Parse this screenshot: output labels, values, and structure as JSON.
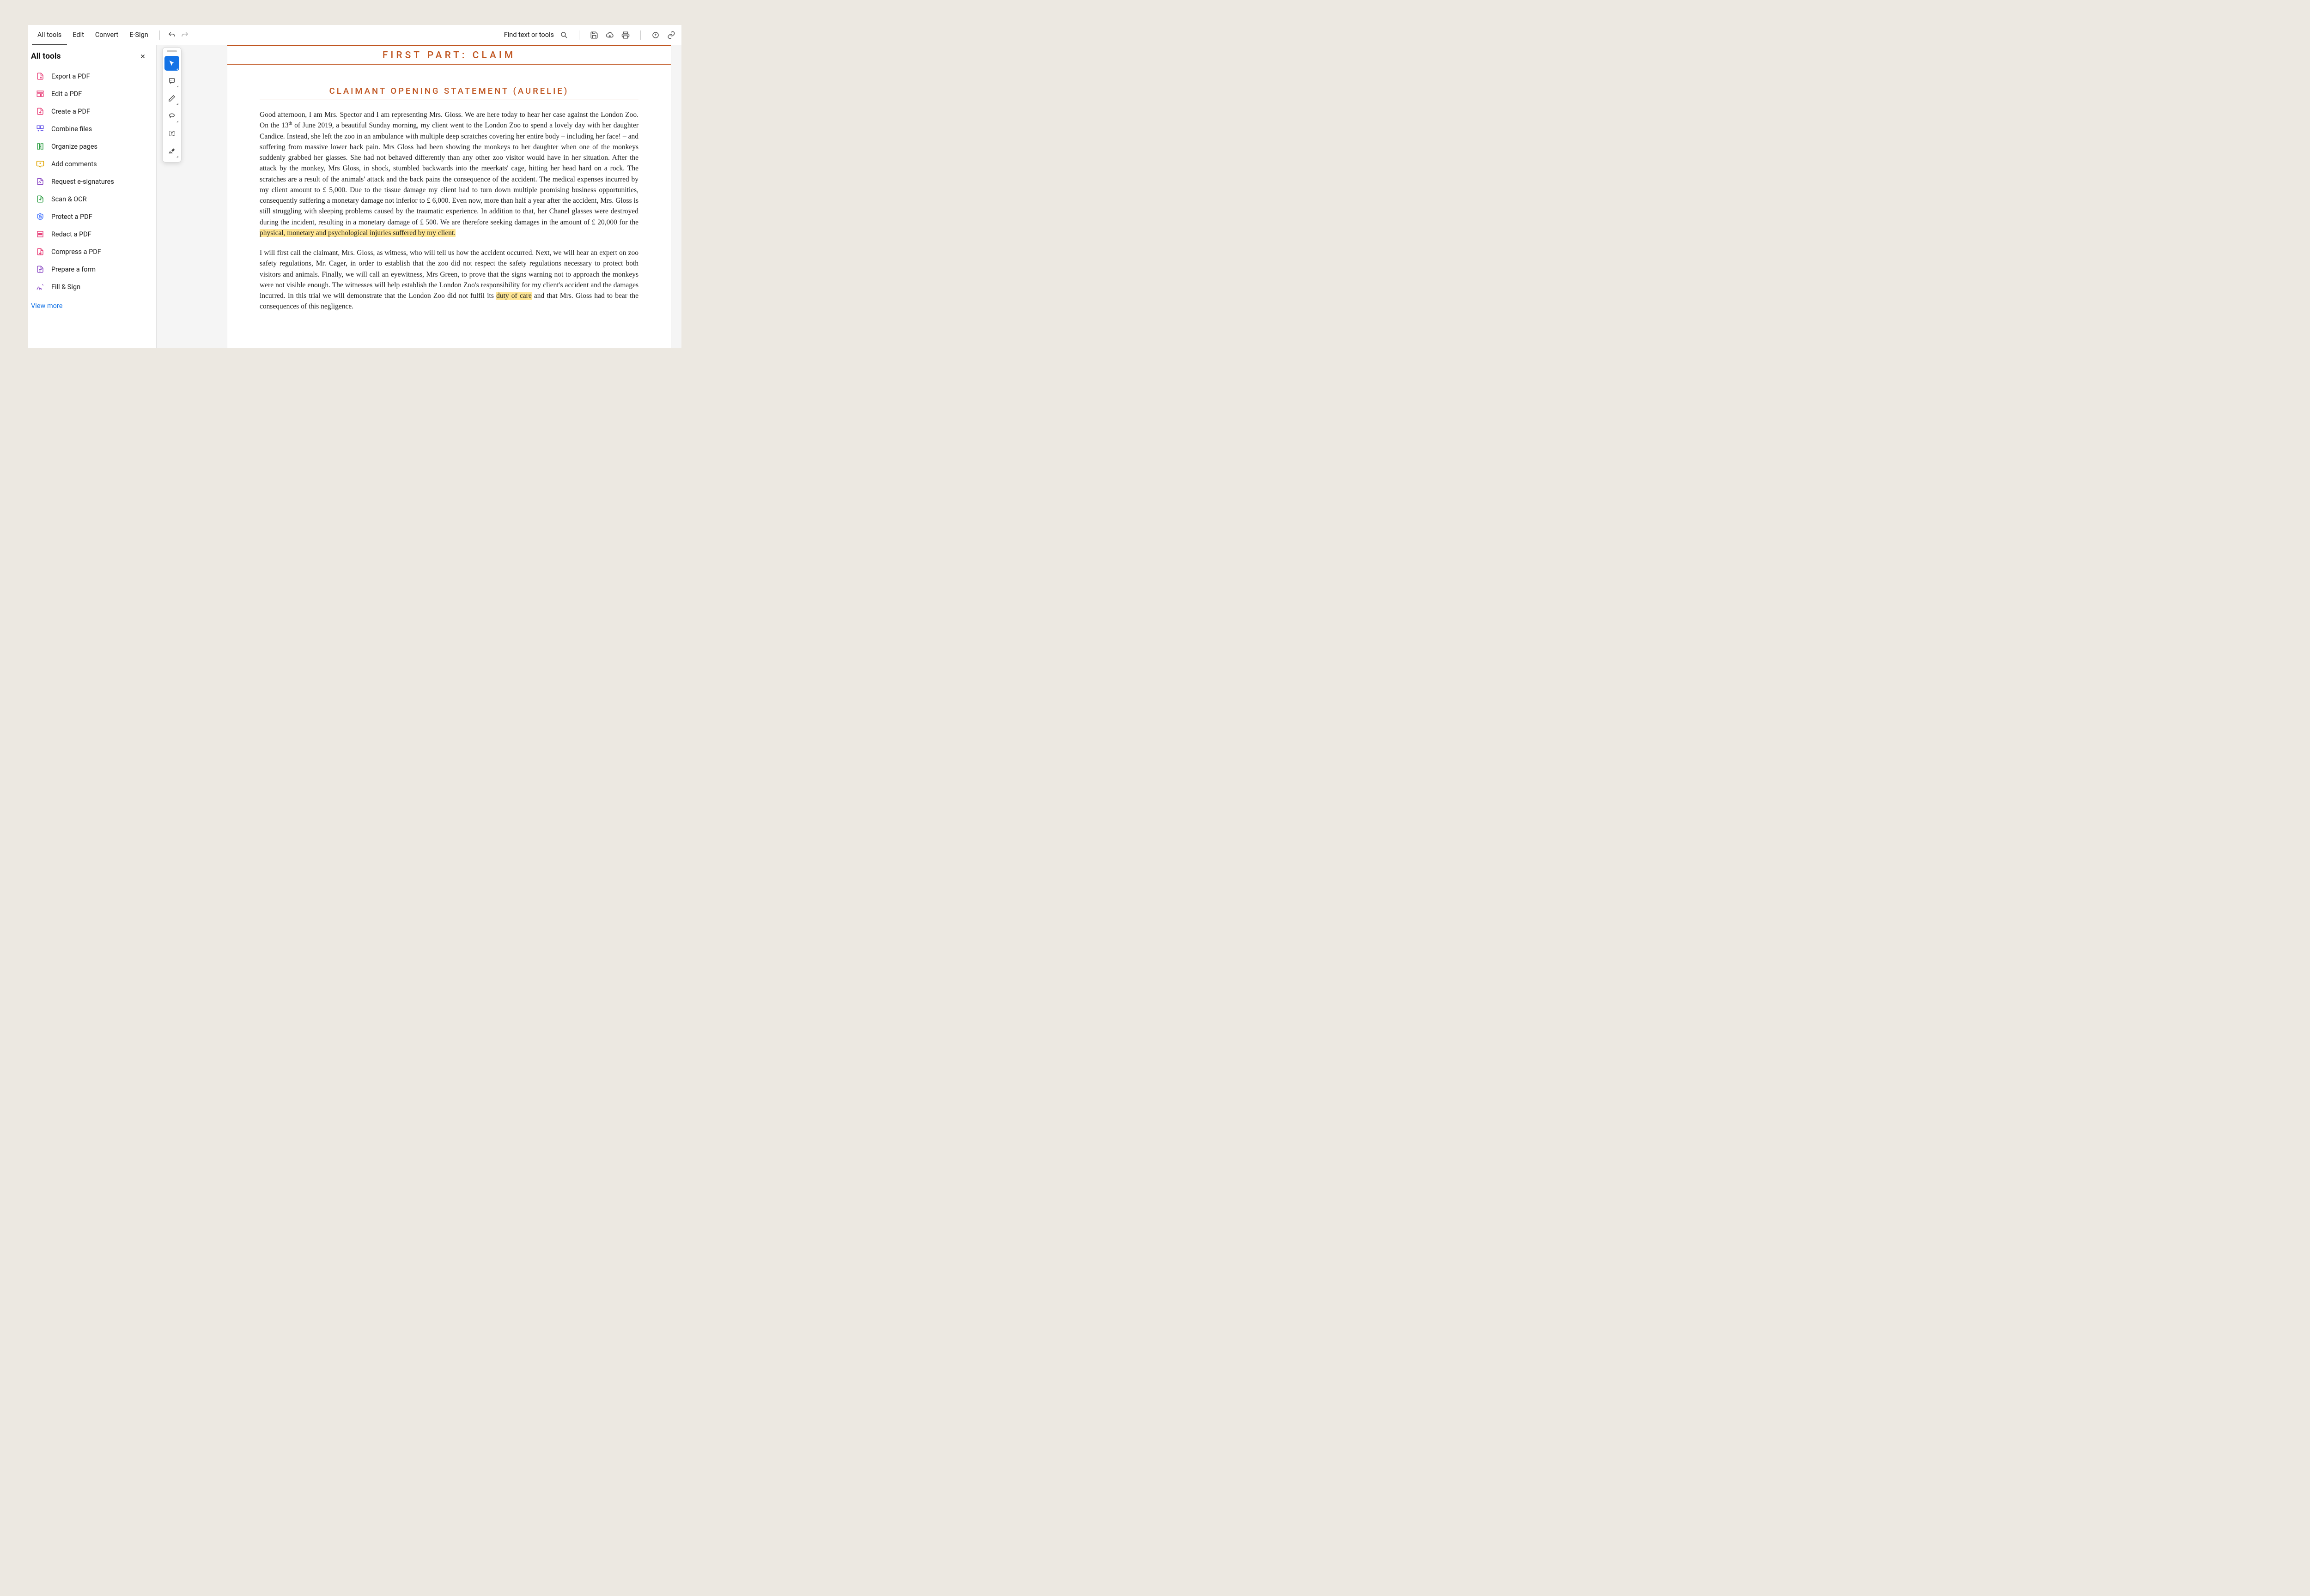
{
  "toolbar": {
    "menu": [
      "All tools",
      "Edit",
      "Convert",
      "E-Sign"
    ],
    "find_label": "Find text or tools"
  },
  "sidebar": {
    "title": "All tools",
    "items": [
      {
        "label": "Export a PDF",
        "color": "#e8447c"
      },
      {
        "label": "Edit a PDF",
        "color": "#e8447c"
      },
      {
        "label": "Create a PDF",
        "color": "#e8447c"
      },
      {
        "label": "Combine files",
        "color": "#6b5ce7"
      },
      {
        "label": "Organize pages",
        "color": "#2e9e44"
      },
      {
        "label": "Add comments",
        "color": "#e0a500"
      },
      {
        "label": "Request e-signatures",
        "color": "#8e4ec6"
      },
      {
        "label": "Scan & OCR",
        "color": "#2e9e44"
      },
      {
        "label": "Protect a PDF",
        "color": "#4f7cff"
      },
      {
        "label": "Redact a PDF",
        "color": "#e8447c"
      },
      {
        "label": "Compress a PDF",
        "color": "#e8447c"
      },
      {
        "label": "Prepare a form",
        "color": "#8e4ec6"
      },
      {
        "label": "Fill & Sign",
        "color": "#8e4ec6"
      }
    ],
    "view_more": "View more"
  },
  "document": {
    "h1": "FIRST PART: CLAIM",
    "h2": "CLAIMANT OPENING STATEMENT (AURELIE)",
    "p1_a": "Good afternoon, I am Mrs. Spector and I am representing Mrs. Gloss. We are here today to hear her case against the London Zoo. On the 13",
    "p1_sup": "th",
    "p1_b": " of June 2019, a beautiful Sunday morning, my client went to the London Zoo to spend a lovely day with her daughter Candice. Instead, she left the zoo in an ambulance with multiple deep scratches covering her entire body – including her face! – and suffering from massive lower back pain. Mrs Gloss had been showing the monkeys to her daughter when one of the monkeys suddenly grabbed her glasses. She had not behaved differently than any other zoo visitor would have in her situation. After the attack by the monkey, Mrs Gloss, in shock, stumbled backwards into the meerkats' cage, hitting her head hard on a rock. The scratches are a result of the animals' attack and the back pains the consequence of the accident. The medical expenses incurred by my client amount to £ 5,000. Due to the tissue damage my client had to turn down multiple promising business opportunities, consequently suffering a monetary damage not inferior to £ 6,000. Even now, more than half a year after the accident, Mrs. Gloss is still struggling with sleeping problems caused by the traumatic experience. In addition to that, her Chanel glasses were destroyed during the incident, resulting in a monetary damage of £ 500. We are therefore seeking damages in the amount of £ 20,000 for the ",
    "p1_hl": "physical, monetary and psychological injuries suffered by my client.",
    "p2_a": "I will first call the claimant, Mrs. Gloss, as witness, who will tell us how the accident occurred. Next, we will hear an expert on zoo safety regulations, Mr. Cager, in order to establish that the zoo did not respect the safety regulations necessary to protect both visitors and animals. Finally, we will call an eyewitness, Mrs Green, to prove that the signs warning not to approach the monkeys were not visible enough. The witnesses will help establish the London Zoo's responsibility for my client's accident and the damages incurred. In this trial we will demonstrate that the London Zoo did not fulfil its ",
    "p2_hl": "duty of care",
    "p2_b": " and that Mrs. Gloss had to bear the consequences of this negligence."
  }
}
